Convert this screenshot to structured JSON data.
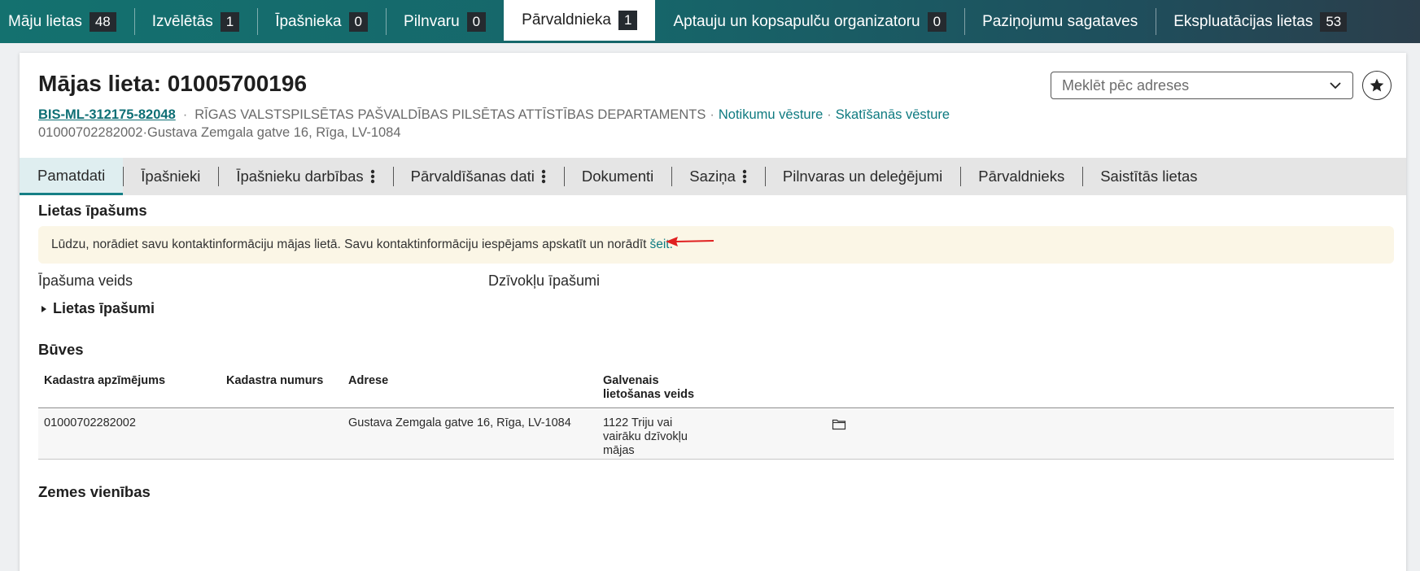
{
  "topnav": {
    "items": [
      {
        "label": "Māju lietas",
        "count": "48"
      },
      {
        "label": "Izvēlētās",
        "count": "1"
      },
      {
        "label": "Īpašnieka",
        "count": "0"
      },
      {
        "label": "Pilnvaru",
        "count": "0"
      },
      {
        "label": "Pārvaldnieka",
        "count": "1",
        "active": true
      },
      {
        "label": "Aptauju un kopsapulču organizatoru",
        "count": "0"
      },
      {
        "label": "Paziņojumu sagataves",
        "count": ""
      },
      {
        "label": "Ekspluatācijas lietas",
        "count": "53"
      }
    ]
  },
  "header": {
    "title": "Mājas lieta: 01005700196",
    "case_id": "BIS-ML-312175-82048",
    "department": "RĪGAS VALSTSPILSĒTAS PAŠVALDĪBAS PILSĒTAS ATTĪSTĪBAS DEPARTAMENTS",
    "link_events": "Notikumu vēsture",
    "link_views": "Skatīšanās vēsture",
    "cadastre": "01000702282002",
    "address": "Gustava Zemgala gatve 16, Rīga, LV-1084",
    "search_placeholder": "Meklēt pēc adreses"
  },
  "tabs": [
    {
      "label": "Pamatdati",
      "active": true
    },
    {
      "label": "Īpašnieki"
    },
    {
      "label": "Īpašnieku darbības",
      "menu": true
    },
    {
      "label": "Pārvaldīšanas dati",
      "menu": true
    },
    {
      "label": "Dokumenti"
    },
    {
      "label": "Saziņa",
      "menu": true
    },
    {
      "label": "Pilnvaras un deleģējumi"
    },
    {
      "label": "Pārvaldnieks"
    },
    {
      "label": "Saistītās lietas"
    }
  ],
  "property": {
    "section_title": "Lietas īpašums",
    "notice_text": "Lūdzu, norādiet savu kontaktinformāciju mājas lietā. Savu kontaktinformāciju iespējams apskatīt un norādīt",
    "notice_link": "šeit.",
    "type_label": "Īpašuma veids",
    "type_value": "Dzīvokļu īpašumi",
    "expander_label": "Lietas īpašumi"
  },
  "buildings": {
    "section_title": "Būves",
    "columns": [
      "Kadastra apzīmējums",
      "Kadastra numurs",
      "Adrese",
      "Galvenais lietošanas veids"
    ],
    "rows": [
      {
        "cadastre_designation": "01000702282002",
        "cadastre_number": "",
        "address": "Gustava Zemgala gatve 16, Rīga, LV-1084",
        "usage": "1122 Triju vai vairāku dzīvokļu mājas"
      }
    ]
  },
  "land": {
    "section_title": "Zemes vienības"
  },
  "colors": {
    "nav_teal": "#14716f",
    "link_teal": "#0e7a80",
    "notice_bg": "#fbf6e6",
    "arrow_red": "#e02020"
  }
}
